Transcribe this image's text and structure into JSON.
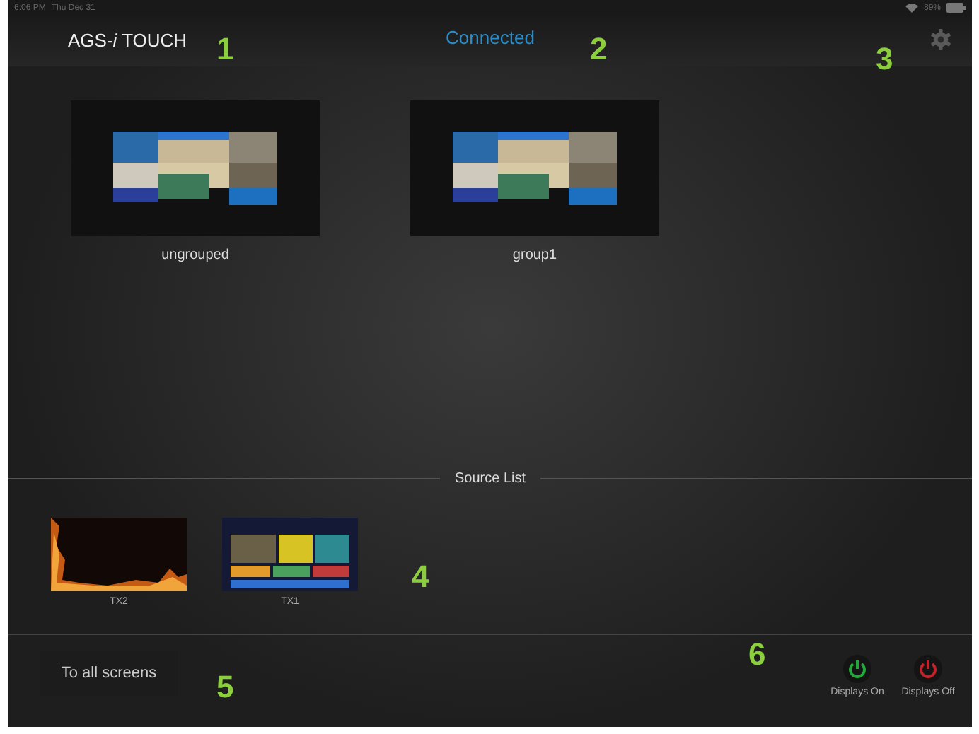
{
  "status_bar": {
    "time": "6:06 PM",
    "date": "Thu Dec 31",
    "battery": "89%"
  },
  "header": {
    "title": "AGS-*i* TOUCH",
    "connection": "Connected"
  },
  "groups": [
    {
      "name": "ungrouped",
      "kind": "picture"
    },
    {
      "name": "group1",
      "kind": "picture"
    }
  ],
  "source_list": {
    "title": "Source List",
    "sources": [
      {
        "name": "TX2",
        "kind": "fire"
      },
      {
        "name": "TX1",
        "kind": "tv"
      }
    ]
  },
  "footer": {
    "send_button": "To all screens",
    "power_buttons": [
      {
        "label": "Displays On",
        "color": "#22a83a"
      },
      {
        "label": "Displays Off",
        "color": "#c0232b"
      }
    ]
  },
  "callouts": [
    "1",
    "2",
    "3",
    "4",
    "5",
    "6"
  ]
}
